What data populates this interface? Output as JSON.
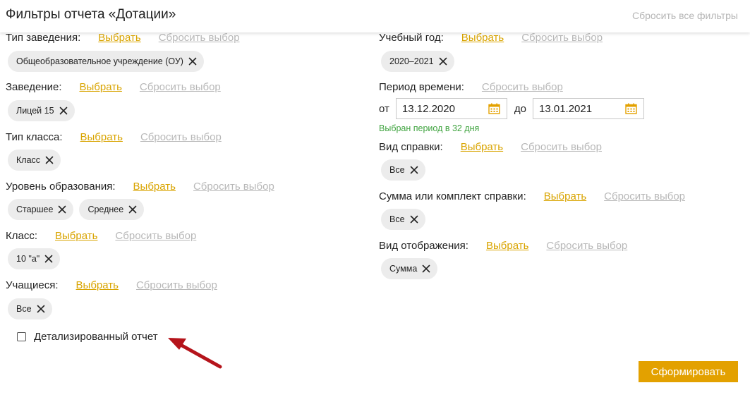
{
  "header": {
    "title": "Фильтры отчета «Дотации»",
    "reset_all": "Сбросить все фильтры"
  },
  "actions": {
    "choose": "Выбрать",
    "reset": "Сбросить выбор"
  },
  "left": {
    "institution_type": {
      "label": "Тип заведения:",
      "chips": [
        "Общеобразовательное учреждение (ОУ)"
      ]
    },
    "institution": {
      "label": "Заведение:",
      "chips": [
        "Лицей 15"
      ]
    },
    "class_type": {
      "label": "Тип класса:",
      "chips": [
        "Класс"
      ]
    },
    "education_level": {
      "label": "Уровень образования:",
      "chips": [
        "Старшее",
        "Среднее"
      ]
    },
    "class": {
      "label": "Класс:",
      "chips": [
        "10 \"а\""
      ]
    },
    "students": {
      "label": "Учащиеся:",
      "chips": [
        "Все"
      ]
    },
    "detailed": {
      "label": "Детализированный отчет",
      "checked": false
    }
  },
  "right": {
    "academic_year": {
      "label": "Учебный год:",
      "chips": [
        "2020–2021"
      ]
    },
    "period": {
      "label": "Период времени:",
      "from_label": "от",
      "from_value": "13.12.2020",
      "to_label": "до",
      "to_value": "13.01.2021",
      "note": "Выбран период в 32 дня"
    },
    "certificate_type": {
      "label": "Вид справки:",
      "chips": [
        "Все"
      ]
    },
    "amount": {
      "label": "Сумма или комплект справки:",
      "chips": [
        "Все"
      ]
    },
    "display_type": {
      "label": "Вид отображения:",
      "chips": [
        "Сумма"
      ]
    }
  },
  "submit_label": "Сформировать",
  "colors": {
    "accent": "#e3a100",
    "link": "#d9a400",
    "muted": "#b8b8b8",
    "chip_bg": "#ececec",
    "success": "#3ea33e",
    "annotation_arrow": "#b5141b"
  }
}
